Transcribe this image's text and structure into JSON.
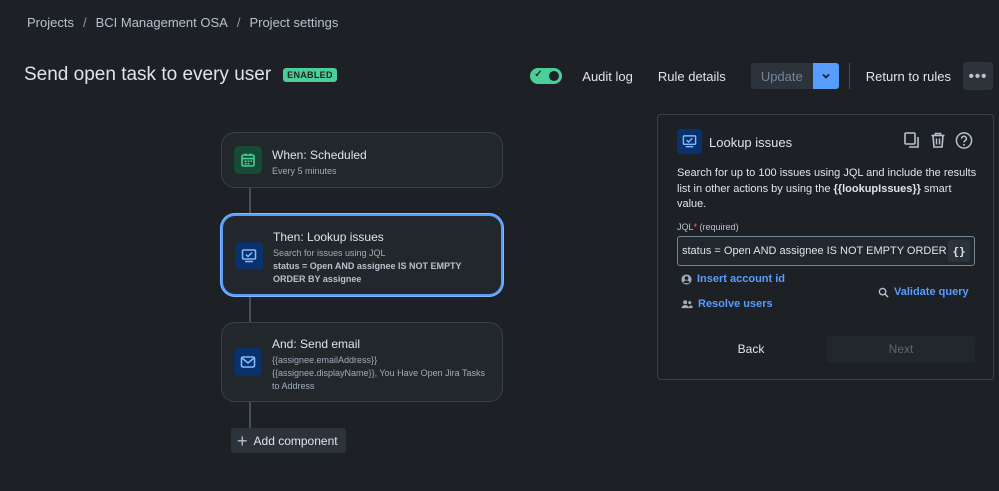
{
  "breadcrumb": {
    "items": [
      "Projects",
      "BCI Management OSA",
      "Project settings"
    ],
    "separator": "/"
  },
  "header": {
    "title": "Send open task to every user",
    "status_badge": "ENABLED",
    "toggle_on": true,
    "audit_log": "Audit log",
    "rule_details": "Rule details",
    "update": "Update",
    "return_to_rules": "Return to rules",
    "more": "•••"
  },
  "flow": {
    "cards": [
      {
        "title": "When: Scheduled",
        "line1": "Every 5 minutes",
        "icon": "calendar-icon"
      },
      {
        "title": "Then: Lookup issues",
        "line1": "Search for issues using JQL",
        "line2": "status = Open AND assignee IS NOT EMPTY ORDER BY assignee",
        "icon": "lookup-issues-icon"
      },
      {
        "title": "And: Send email",
        "line1": "{{assignee.emailAddress}}",
        "line2": "{{assignee.displayName}}, You Have Open Jira Tasks to Address",
        "icon": "mail-icon"
      }
    ],
    "add_component": "Add component"
  },
  "panel": {
    "title": "Lookup issues",
    "desc_prefix": "Search for up to 100 issues using JQL and include the results list in other actions by using the ",
    "desc_smart": "{{lookupIssues}}",
    "desc_suffix": " smart value.",
    "jql_label": "JQL",
    "jql_required_mark": "*",
    "jql_required_text": "(required)",
    "jql_value": "status = Open AND assignee IS NOT EMPTY ORDER BY assignee",
    "braces": "{}",
    "insert_account_id": "Insert account id",
    "validate_query": "Validate query",
    "resolve_users": "Resolve users",
    "back": "Back",
    "next": "Next"
  },
  "colors": {
    "background": "#1d2125",
    "accent": "#579dff",
    "enabled_green": "#4bce97"
  }
}
